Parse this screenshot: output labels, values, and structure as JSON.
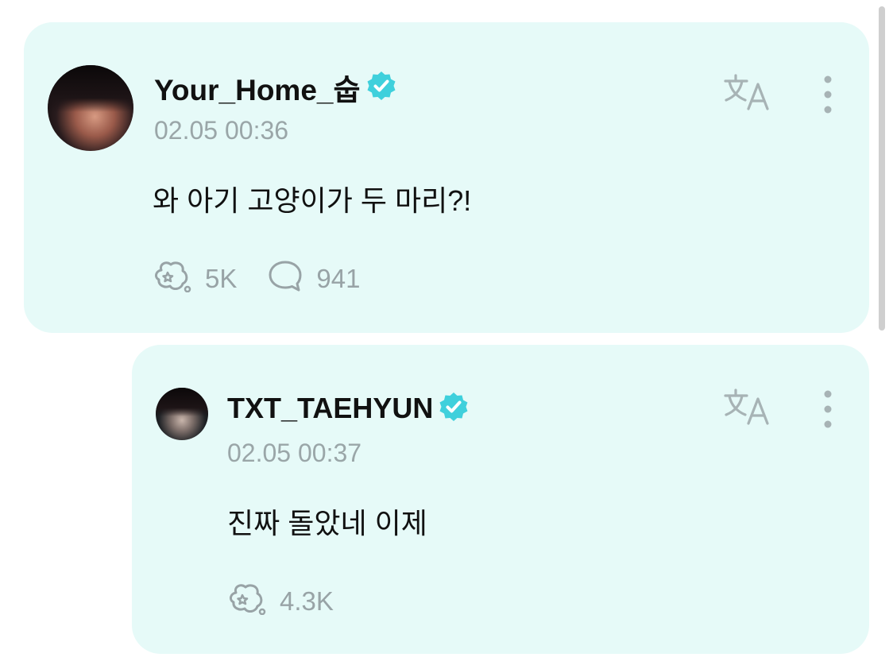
{
  "post": {
    "username": "Your_Home_숩",
    "timestamp": "02.05 00:36",
    "content": "와 아기 고양이가 두 마리?!",
    "reactions_count": "5K",
    "comments_count": "941",
    "verified": true
  },
  "reply": {
    "username": "TXT_TAEHYUN",
    "timestamp": "02.05 00:37",
    "content": "진짜 돌았네 이제",
    "reactions_count": "4.3K",
    "verified": true
  },
  "icons": {
    "verified": "verified-badge-icon",
    "translate": "translate-icon",
    "more": "more-vertical-icon",
    "reaction": "reaction-icon",
    "comment": "comment-icon"
  },
  "colors": {
    "card_background": "#e6faf8",
    "verified_badge": "#3fd0dc",
    "muted_text": "#98a3a6",
    "primary_text": "#111111"
  }
}
